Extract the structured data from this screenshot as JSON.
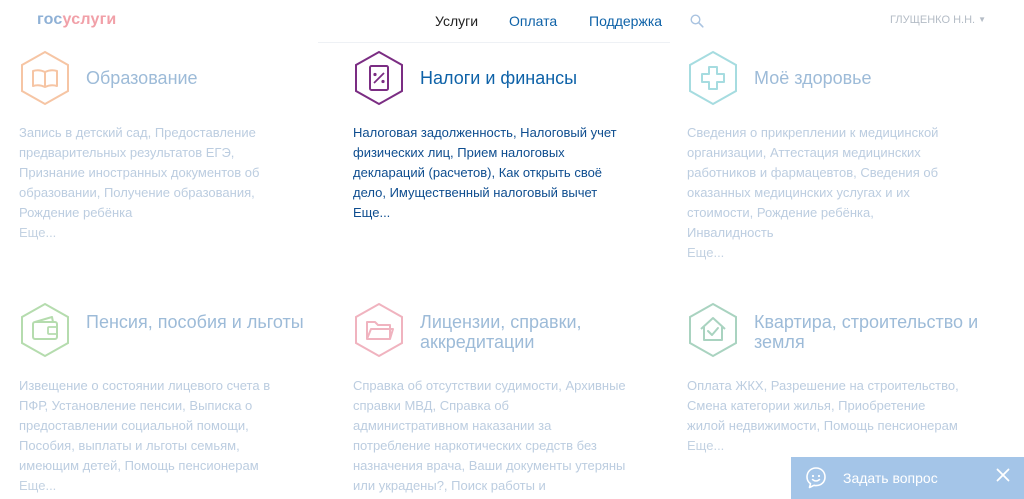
{
  "header": {
    "logo_part1": "гос",
    "logo_part2": "услуги",
    "nav": [
      "Услуги",
      "Оплата",
      "Поддержка"
    ],
    "user": "ГЛУЩЕНКО Н.Н."
  },
  "categories": [
    {
      "title": "Образование",
      "desc": "Запись в детский сад, Предоставление предварительных результатов ЕГЭ, Признание иностранных документов об образовании, Получение образования, Рождение ребёнка",
      "more": "Еще...",
      "icon": "book-icon",
      "color": "#f6c5a4"
    },
    {
      "title": "Налоги и финансы",
      "desc": "Налоговая задолженность, Налоговый учет физических лиц, Прием налоговых деклараций (расчетов), Как открыть своё дело, Имущественный налоговый вычет",
      "more": "Еще...",
      "icon": "tax-document-icon",
      "color": "#7b2d83"
    },
    {
      "title": "Моё здоровье",
      "desc": "Сведения о прикреплении к медицинской организации, Аттестация медицинских работников и фармацевтов, Сведения об оказанных медицинских услугах и их стоимости, Рождение ребёнка, Инвалидность",
      "more": "Еще...",
      "icon": "medical-cross-icon",
      "color": "#a6dce0"
    },
    {
      "title": "Пенсия, пособия и льготы",
      "desc": "Извещение о состоянии лицевого счета в ПФР, Установление пенсии, Выписка о предоставлении социальной помощи, Пособия, выплаты и льготы семьям, имеющим детей, Помощь пенсионерам",
      "more": "Еще...",
      "icon": "wallet-icon",
      "color": "#b5dcae"
    },
    {
      "title": "Лицензии, справки, аккредитации",
      "desc": "Справка об отсутствии судимости, Архивные справки МВД, Справка об административном наказании за потребление наркотических средств без назначения врача, Ваши документы утеряны или украдены?, Поиск работы и",
      "more": "",
      "icon": "folder-icon",
      "color": "#f0b3bf"
    },
    {
      "title": "Квартира, строительство и земля",
      "desc": "Оплата ЖКХ, Разрешение на строительство, Смена категории жилья, Приобретение жилой недвижимости, Помощь пенсионерам",
      "more": "Еще...",
      "icon": "house-check-icon",
      "color": "#a9d3c0"
    }
  ],
  "chat": {
    "label": "Задать вопрос"
  }
}
